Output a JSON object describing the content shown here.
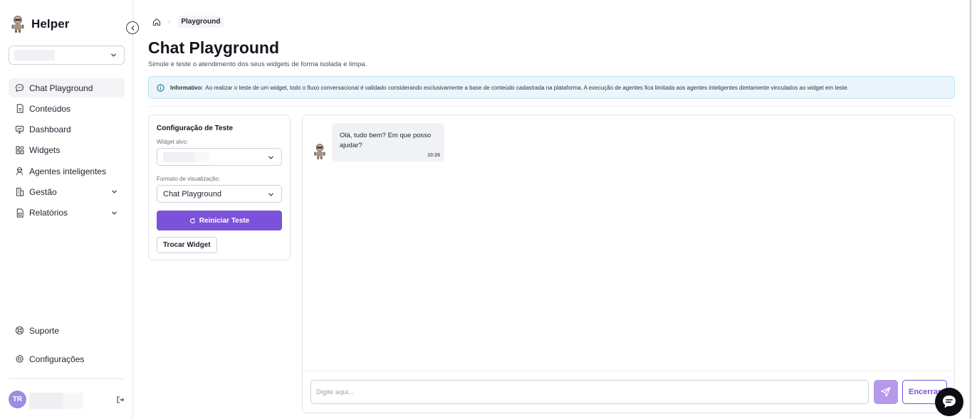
{
  "brand": {
    "name": "Helper"
  },
  "sidebar": {
    "items": [
      {
        "label": "Chat Playground",
        "icon": "chat-icon"
      },
      {
        "label": "Conteúdos",
        "icon": "document-icon"
      },
      {
        "label": "Dashboard",
        "icon": "monitor-icon"
      },
      {
        "label": "Widgets",
        "icon": "widgets-icon"
      },
      {
        "label": "Agentes inteligentes",
        "icon": "agent-icon"
      },
      {
        "label": "Gestão",
        "icon": "building-icon"
      },
      {
        "label": "Relatórios",
        "icon": "report-icon"
      }
    ],
    "bottom": [
      {
        "label": "Suporte",
        "icon": "support-icon"
      },
      {
        "label": "Configurações",
        "icon": "gear-icon"
      }
    ],
    "user": {
      "initials": "TR"
    }
  },
  "breadcrumb": {
    "current": "Playground"
  },
  "page": {
    "title": "Chat Playground",
    "subtitle": "Simule e teste o atendimento dos seus widgets de forma isolada e limpa."
  },
  "info": {
    "label": "Informativo:",
    "text": "Ao realizar o teste de um widget, todo o fluxo conversacional é validado considerando exclusivamente a base de conteúdo cadastrada na plataforma. A execução de agentes fica limitada aos agentes inteligentes diretamente vinculados ao widget em teste."
  },
  "config": {
    "title": "Configuração de Teste",
    "widget_label": "Widget alvo:",
    "format_label": "Formato de visualização:",
    "format_value": "Chat Playground",
    "restart_label": "Reiniciar Teste",
    "switch_label": "Trocar Widget"
  },
  "chat": {
    "messages": [
      {
        "text": "Olá, tudo bem? Em que posso ajudar?",
        "time": "10:26"
      }
    ],
    "input_placeholder": "Digite aqui...",
    "end_label": "Encerrar"
  },
  "colors": {
    "accent": "#7b52d9",
    "accent_light": "#b69ae9",
    "info_bg": "#eaf6fb"
  }
}
